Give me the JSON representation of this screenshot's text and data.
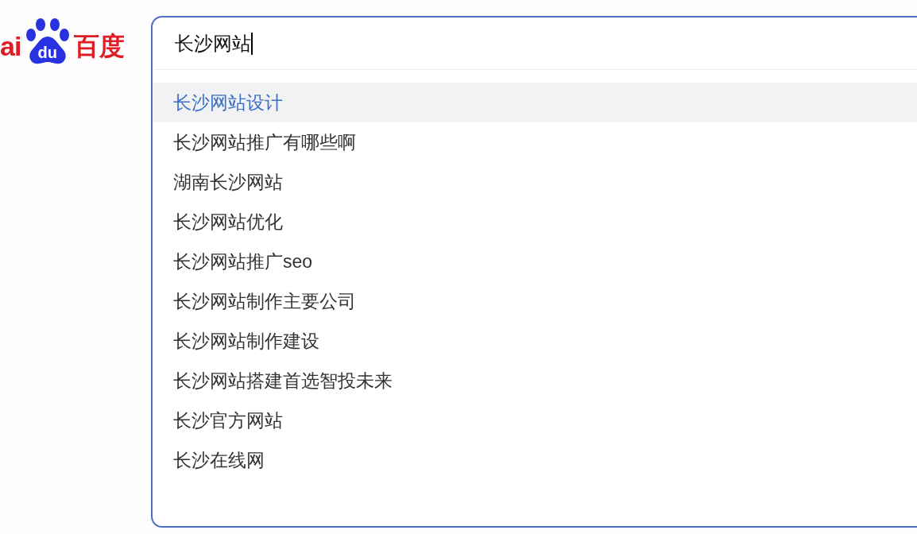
{
  "logo": {
    "latin": "ai",
    "paw": "du",
    "chinese": "百度"
  },
  "search": {
    "value": "长沙网站"
  },
  "suggestions": [
    {
      "text": "长沙网站设计",
      "selected": true
    },
    {
      "text": "长沙网站推广有哪些啊",
      "selected": false
    },
    {
      "text": "湖南长沙网站",
      "selected": false
    },
    {
      "text": "长沙网站优化",
      "selected": false
    },
    {
      "text": "长沙网站推广seo",
      "selected": false
    },
    {
      "text": "长沙网站制作主要公司",
      "selected": false
    },
    {
      "text": "长沙网站制作建设",
      "selected": false
    },
    {
      "text": "长沙网站搭建首选智投未来",
      "selected": false
    },
    {
      "text": "长沙官方网站",
      "selected": false
    },
    {
      "text": "长沙在线网",
      "selected": false
    }
  ]
}
